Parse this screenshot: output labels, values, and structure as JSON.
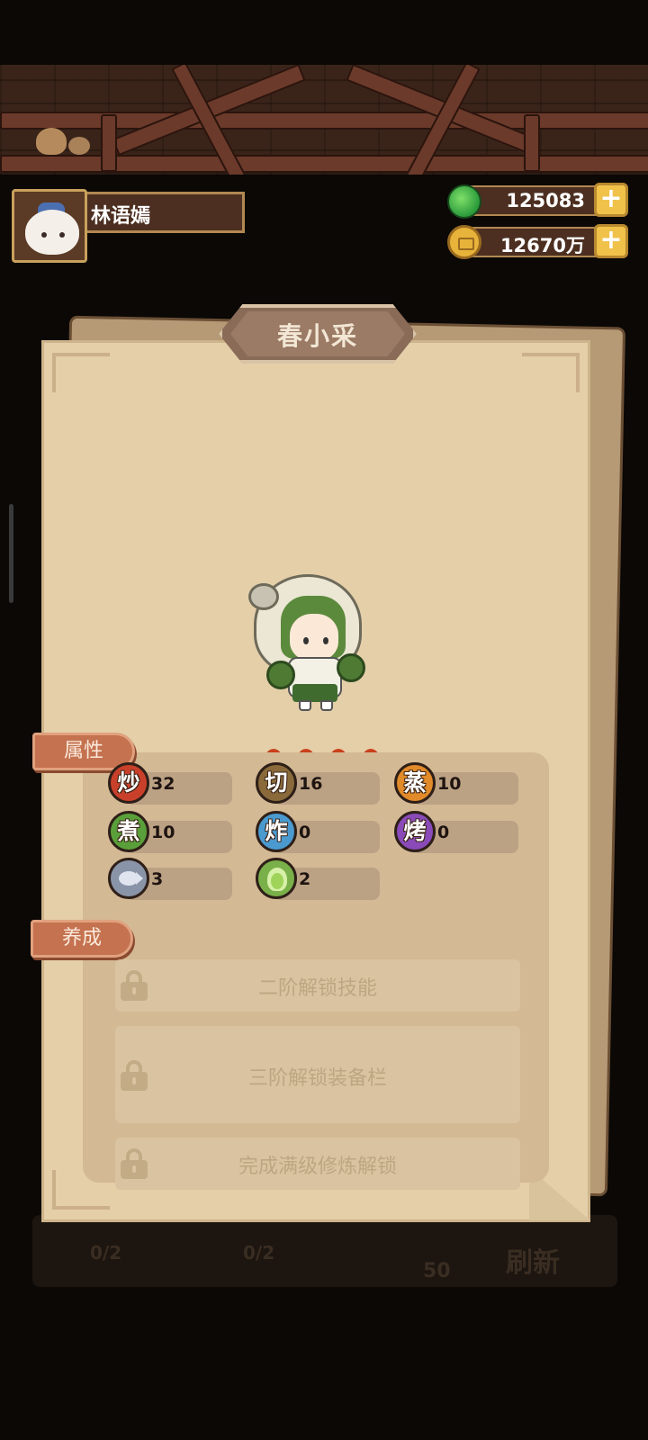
{
  "player": {
    "name": "林语嫣"
  },
  "resources": {
    "jade": "125083",
    "coins": "12670万",
    "plus_symbol": "+"
  },
  "character": {
    "name": "春小采",
    "stars": 4
  },
  "sections": {
    "attributes_label": "属性",
    "cultivation_label": "养成"
  },
  "stats": [
    {
      "skill": "炒",
      "value": "32",
      "color": "#c9402a"
    },
    {
      "skill": "切",
      "value": "16",
      "color": "#8a6a3a"
    },
    {
      "skill": "蒸",
      "value": "10",
      "color": "#e08a2a"
    },
    {
      "skill": "煮",
      "value": "10",
      "color": "#5aa03a"
    },
    {
      "skill": "炸",
      "value": "0",
      "color": "#4a9ad0"
    },
    {
      "skill": "烤",
      "value": "0",
      "color": "#8a4ab8"
    },
    {
      "skill": "fish-icon",
      "value": "3",
      "color": "#8a94a8"
    },
    {
      "skill": "cabbage-icon",
      "value": "2",
      "color": "#7ab04a"
    }
  ],
  "locks": [
    {
      "text": "二阶解锁技能"
    },
    {
      "text": "三阶解锁装备栏"
    },
    {
      "text": "完成满级修炼解锁"
    }
  ],
  "background": {
    "left_count": "0/2",
    "mid_count": "0/2",
    "cost": "50",
    "refresh_label": "刷新"
  }
}
